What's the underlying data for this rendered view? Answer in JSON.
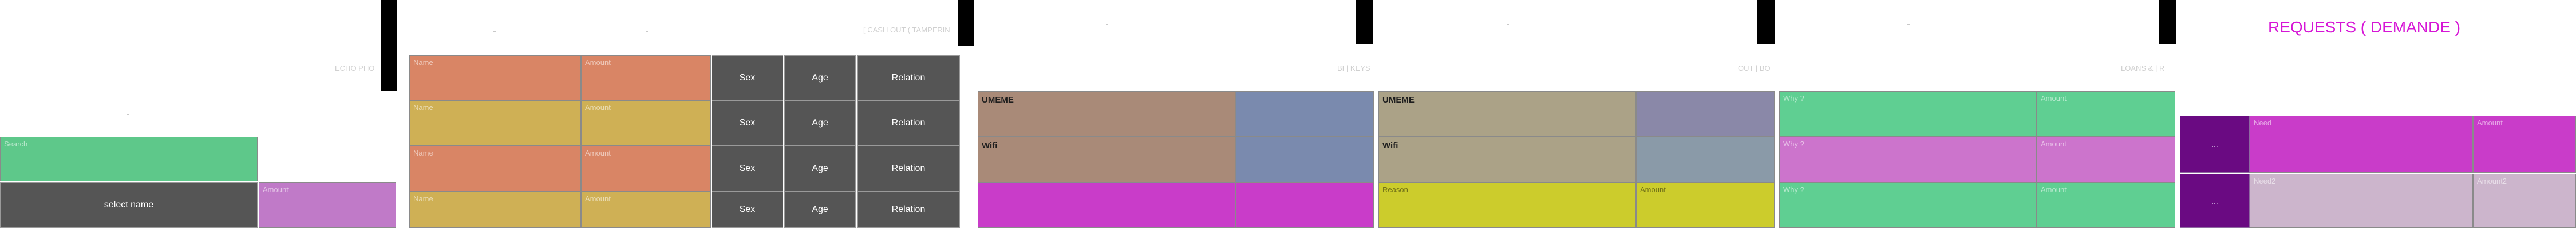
{
  "panel1": {
    "search_placeholder": "Search",
    "select_button": "select name",
    "amount_placeholder": "Amount",
    "faint_right": "ECHO PHO"
  },
  "panel2": {
    "faint_header": "[ CASH OUT ( TAMPERIN",
    "rows": [
      {
        "name": "Name",
        "amount": "Amount",
        "sex": "Sex",
        "age": "Age",
        "relation": "Relation"
      },
      {
        "name": "Name",
        "amount": "Amount",
        "sex": "Sex",
        "age": "Age",
        "relation": "Relation"
      },
      {
        "name": "Name",
        "amount": "Amount",
        "sex": "Sex",
        "age": "Age",
        "relation": "Relation"
      },
      {
        "name": "Name",
        "amount": "Amount",
        "sex": "Sex",
        "age": "Age",
        "relation": "Relation"
      }
    ]
  },
  "panel3": {
    "faint_right": "BI | KEYS",
    "rows": [
      {
        "label": "UMEME"
      },
      {
        "label": "Wifi"
      }
    ]
  },
  "panel4": {
    "faint_right": "OUT | BO",
    "rows": [
      {
        "label": "UMEME"
      },
      {
        "label": "Wifi"
      }
    ],
    "reason_placeholder": "Reason",
    "amount_placeholder": "Amount"
  },
  "panel5": {
    "faint_right": "LOANS & | R",
    "rows": [
      {
        "why": "Why ?",
        "amount": "Amount"
      },
      {
        "why": "Why ?",
        "amount": "Amount"
      },
      {
        "why": "Why ?",
        "amount": "Amount"
      }
    ]
  },
  "panel6": {
    "title": "REQUESTS ( DEMANDE )",
    "rows": [
      {
        "button": "...",
        "need": "Need",
        "amount": "Amount"
      },
      {
        "button": "...",
        "need": "Need2",
        "amount": "Amount2"
      }
    ]
  },
  "colors": {
    "green": "#5ec88a",
    "violet": "#c07ac8",
    "salmon": "#d98565",
    "mustard": "#cfb055",
    "taupe": "#a98a78",
    "slate": "#7a8aae",
    "khaki": "#aba287",
    "slate2": "#8a88a8",
    "magenta": "#c93cc9",
    "yellow": "#cccc2c",
    "green2": "#5fcf92",
    "pink": "#cc74cc",
    "purple": "#6a0a82",
    "lilac": "#ccb5cc",
    "gray_button": "#555555",
    "title": "#d616d6"
  }
}
